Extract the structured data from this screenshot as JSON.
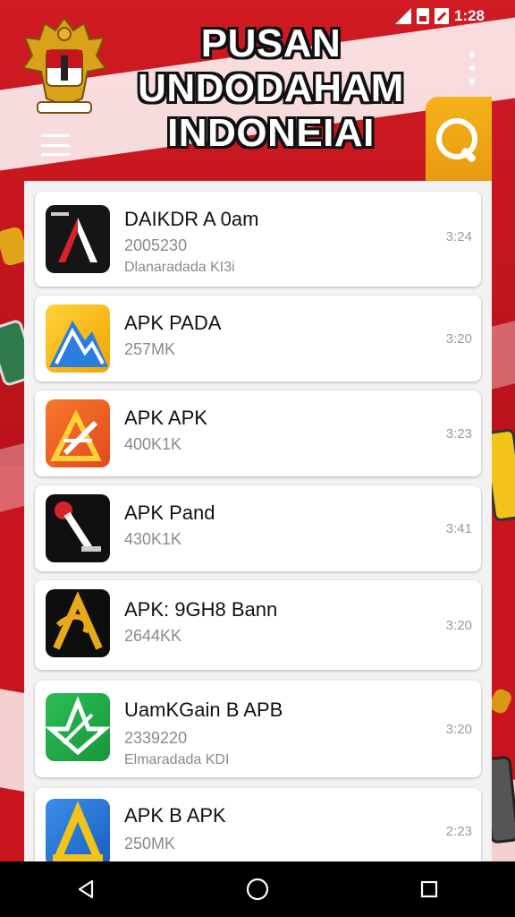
{
  "status_bar": {
    "time": "1:28"
  },
  "header": {
    "title_lines": [
      "PUSAN",
      "UNDODAHAM",
      "INDONEIAI"
    ],
    "emblem_icon": "garuda-emblem-icon",
    "menu_icon": "hamburger-menu-icon",
    "more_icon": "more-vert-icon",
    "search_icon": "search-icon"
  },
  "colors": {
    "brand_red": "#c8141c",
    "accent_orange": "#f0a818",
    "card_bg": "#ffffff"
  },
  "apps": [
    {
      "name": "DAIKDR A 0am",
      "size": "2005230",
      "developer": "Dlanaradada KI3i",
      "time": "3:24",
      "icon": "app-icon-a-black"
    },
    {
      "name": "APK PADA",
      "size": "257MK",
      "developer": "",
      "time": "3:20",
      "icon": "app-icon-blue-mountain"
    },
    {
      "name": "APK  APK",
      "size": "400K1K",
      "developer": "",
      "time": "3:23",
      "icon": "app-icon-orange-pencil"
    },
    {
      "name": "APK Pand",
      "size": "430K1K",
      "developer": "",
      "time": "3:41",
      "icon": "app-icon-black-pin"
    },
    {
      "name": "APK: 9GH8 Bann",
      "size": "2644KK",
      "developer": "",
      "time": "3:20",
      "icon": "app-icon-black-gold-a"
    },
    {
      "name": "UamKGain B APB",
      "size": "2339220",
      "developer": "Elmaradada KDI",
      "time": "3:20",
      "icon": "app-icon-green-star"
    },
    {
      "name": "APK B APK",
      "size": "250MK",
      "developer": "",
      "time": "2:23",
      "icon": "app-icon-blue-gold-a"
    }
  ],
  "nav": {
    "back_icon": "back-icon",
    "home_icon": "home-icon",
    "recents_icon": "recents-icon"
  }
}
